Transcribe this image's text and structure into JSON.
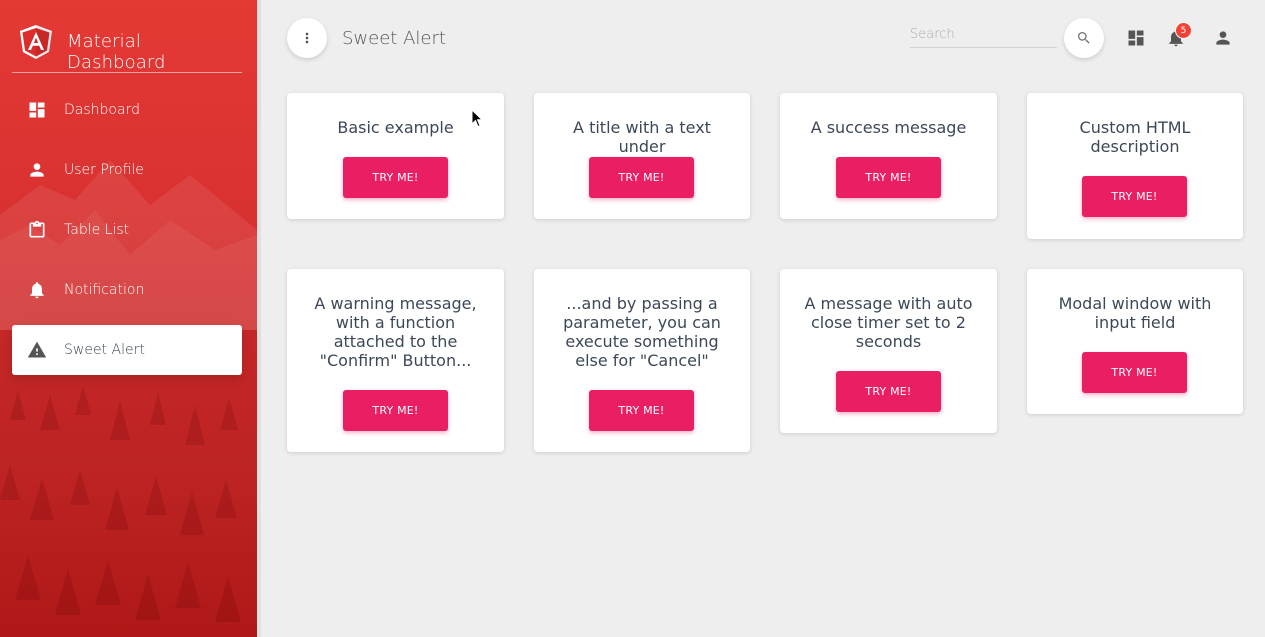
{
  "brand": {
    "name": "Material Dashboard",
    "logo_icon": "angular-logo-icon"
  },
  "sidebar": {
    "items": [
      {
        "label": "Dashboard",
        "icon": "dashboard-icon"
      },
      {
        "label": "User Profile",
        "icon": "person-icon"
      },
      {
        "label": "Table List",
        "icon": "clipboard-icon"
      },
      {
        "label": "Notification",
        "icon": "bell-icon"
      },
      {
        "label": "Sweet Alert",
        "icon": "warning-icon",
        "active": true
      }
    ]
  },
  "header": {
    "title": "Sweet Alert",
    "search_placeholder": "Search",
    "notification_count": "5"
  },
  "cards": [
    {
      "title": "Basic example",
      "button": "TRY ME!"
    },
    {
      "title": "A title with a text under",
      "button": "TRY ME!"
    },
    {
      "title": "A success message",
      "button": "TRY ME!"
    },
    {
      "title": "Custom HTML description",
      "button": "TRY ME!"
    },
    {
      "title": "A warning message, with a function attached to the \"Confirm\" Button...",
      "button": "TRY ME!"
    },
    {
      "title": "...and by passing a parameter, you can execute something else for \"Cancel\"",
      "button": "TRY ME!"
    },
    {
      "title": "A message with auto close timer set to 2 seconds",
      "button": "TRY ME!"
    },
    {
      "title": "Modal window with input field",
      "button": "TRY ME!"
    }
  ],
  "colors": {
    "sidebar": "#d32f2f",
    "accent_button": "#e91e63",
    "badge": "#f44336",
    "background": "#eeeeee"
  }
}
